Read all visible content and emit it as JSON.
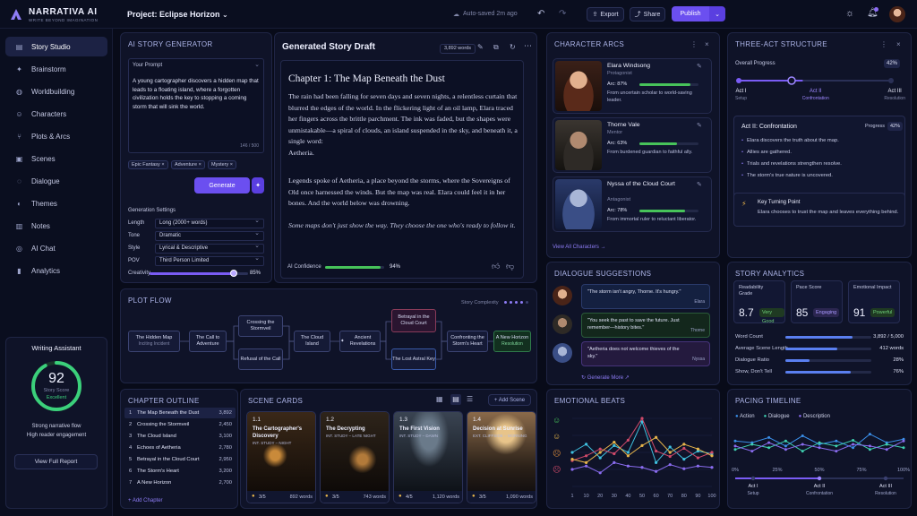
{
  "app": {
    "name": "NARRATIVA AI",
    "tagline": "WRITE BEYOND IMAGINATION"
  },
  "project": {
    "label": "Project: Eclipse Horizon",
    "autosave": "Auto-saved 2m ago"
  },
  "toolbar": {
    "export": "Export",
    "share": "Share",
    "publish": "Publish"
  },
  "sidebar": {
    "items": [
      {
        "label": "Story Studio",
        "icon": "book-icon"
      },
      {
        "label": "Brainstorm",
        "icon": "sparkle-icon"
      },
      {
        "label": "Worldbuilding",
        "icon": "globe-icon"
      },
      {
        "label": "Characters",
        "icon": "person-icon"
      },
      {
        "label": "Plots & Arcs",
        "icon": "branch-icon"
      },
      {
        "label": "Scenes",
        "icon": "film-icon"
      },
      {
        "label": "Dialogue",
        "icon": "chat-icon"
      },
      {
        "label": "Themes",
        "icon": "palette-icon"
      },
      {
        "label": "Notes",
        "icon": "note-icon"
      },
      {
        "label": "AI Chat",
        "icon": "bot-icon"
      },
      {
        "label": "Analytics",
        "icon": "chart-icon"
      }
    ]
  },
  "assistant": {
    "title": "Writing Assistant",
    "score": "92",
    "score_label": "Story Score",
    "score_grade": "Excellent",
    "score_fraction": 0.92,
    "line1": "Strong narrative flow",
    "line2": "High reader engagement",
    "button": "View Full Report"
  },
  "generator": {
    "title": "AI STORY GENERATOR",
    "prompt_label": "Your Prompt",
    "prompt_text": "A young cartographer discovers a hidden map that leads to a floating island, where a forgotten civilization holds the key to stopping a coming storm that will sink the world.",
    "count": "146 / 500",
    "tags": [
      "Epic Fantasy ×",
      "Adventure ×",
      "Mystery ×"
    ],
    "generate": "Generate",
    "settings_title": "Generation Settings",
    "settings": [
      {
        "label": "Length",
        "value": "Long (2000+ words)"
      },
      {
        "label": "Tone",
        "value": "Dramatic"
      },
      {
        "label": "Style",
        "value": "Lyrical & Descriptive"
      },
      {
        "label": "POV",
        "value": "Third Person Limited"
      }
    ],
    "creativity_label": "Creativity",
    "creativity": "85%",
    "creativity_fraction": 0.85
  },
  "draft": {
    "title": "Generated Story Draft",
    "words": "3,892 words",
    "chapter": "Chapter 1: The Map Beneath the Dust",
    "p1": "The rain had been falling for seven days and seven nights, a relentless curtain that blurred the edges of the world. In the flickering light of an oil lamp, Elara traced her fingers across the brittle parchment. The ink was faded, but the shapes were unmistakable—a spiral of clouds, an island suspended in the sky, and beneath it, a single word:",
    "p1b": "Aetheria.",
    "p2": "Legends spoke of Aetheria, a place beyond the storms, where the Sovereigns of Old once harnessed the winds. But the map was real. Elara could feel it in her bones. And the world below was drowning.",
    "p3": "Some maps don't just show the way. They choose the one who's ready to follow it.",
    "confidence_label": "AI Confidence",
    "confidence": "94%",
    "confidence_fraction": 0.94
  },
  "arcs": {
    "title": "CHARACTER ARCS",
    "view_all": "View All Characters →",
    "items": [
      {
        "name": "Elara Windsong",
        "role": "Protagonist",
        "arc": "Arc:  87%",
        "arc_fraction": 0.87,
        "desc": "From uncertain scholar to world-saving leader."
      },
      {
        "name": "Thorne Vale",
        "role": "Mentor",
        "arc": "Arc:  63%",
        "arc_fraction": 0.63,
        "desc": "From burdened guardian to faithful ally."
      },
      {
        "name": "Nyssa of the Cloud Court",
        "role": "Antagonist",
        "arc": "Arc:  78%",
        "arc_fraction": 0.78,
        "desc": "From immortal ruler to reluctant liberator."
      }
    ]
  },
  "acts": {
    "title": "THREE-ACT STRUCTURE",
    "progress_label": "Overall Progress",
    "progress": "42%",
    "progress_fraction": 0.42,
    "steps": [
      {
        "name": "Act I",
        "sub": "Setup"
      },
      {
        "name": "Act II",
        "sub": "Confrontation"
      },
      {
        "name": "Act III",
        "sub": "Resolution"
      }
    ],
    "current": "Act II: Confrontation",
    "current_progress_label": "Progress",
    "current_progress": "42%",
    "bullets": [
      "Elara discovers the truth about the map.",
      "Allies are gathered.",
      "Trials and revelations strengthen resolve.",
      "The storm's true nature is uncovered."
    ],
    "turning_title": "Key Turning Point",
    "turning_text": "Elara chooses to trust the map and leaves everything behind."
  },
  "plot": {
    "title": "PLOT FLOW",
    "complexity_label": "Story Complexity",
    "nodes": [
      "The Hidden Map",
      "Inciting Incident",
      "The Call to Adventure",
      "Crossing the Stormveil",
      "Refusal of the Call",
      "The Cloud Island",
      "Ancient Revelations",
      "Betrayal in the Cloud Court",
      "The Lost Astral Key",
      "Confronting the Storm's Heart",
      "A New Horizon",
      "Resolution"
    ]
  },
  "outline": {
    "title": "CHAPTER OUTLINE",
    "add": "+ Add Chapter",
    "rows": [
      {
        "n": "1",
        "t": "The Map Beneath the Dust",
        "w": "3,892"
      },
      {
        "n": "2",
        "t": "Crossing the Stormveil",
        "w": "2,450"
      },
      {
        "n": "3",
        "t": "The Cloud Island",
        "w": "3,100"
      },
      {
        "n": "4",
        "t": "Echoes of Aetheria",
        "w": "2,780"
      },
      {
        "n": "5",
        "t": "Betrayal in the Cloud Court",
        "w": "2,950"
      },
      {
        "n": "6",
        "t": "The Storm's Heart",
        "w": "3,200"
      },
      {
        "n": "7",
        "t": "A New Horizon",
        "w": "2,700"
      }
    ]
  },
  "scenes": {
    "title": "SCENE CARDS",
    "add": "+ Add Scene",
    "items": [
      {
        "num": "1.1",
        "title": "The Cartographer's Discovery",
        "meta": "INT. STUDY – NIGHT",
        "rating": "3/5",
        "words": "892 words"
      },
      {
        "num": "1.2",
        "title": "The Decrypting",
        "meta": "INT. STUDY – LATE NIGHT",
        "rating": "3/5",
        "words": "743 words"
      },
      {
        "num": "1.3",
        "title": "The First Vision",
        "meta": "INT. STUDY – DAWN",
        "rating": "4/5",
        "words": "1,120 words"
      },
      {
        "num": "1.4",
        "title": "Decision at Sunrise",
        "meta": "EXT. CLIFFSIDE – MORNING",
        "rating": "3/5",
        "words": "1,090 words"
      }
    ]
  },
  "dialogue": {
    "title": "DIALOGUE SUGGESTIONS",
    "generate": "Generate More ↗",
    "items": [
      {
        "text": "\"The storm isn't angry, Thorne. It's hungry.\"",
        "who": "Elara"
      },
      {
        "text": "\"You seek the past to save the future. Just remember—history bites.\"",
        "who": "Thorne"
      },
      {
        "text": "\"Aetheria does not welcome thieves of the sky.\"",
        "who": "Nyssa"
      }
    ]
  },
  "analytics": {
    "title": "STORY ANALYTICS",
    "metrics": [
      {
        "label": "Readability Grade",
        "value": "8.7",
        "badge": "Very Good"
      },
      {
        "label": "Pace Score",
        "value": "85",
        "badge": "Engaging"
      },
      {
        "label": "Emotional Impact",
        "value": "91",
        "badge": "Powerful"
      }
    ],
    "rows": [
      {
        "label": "Word Count",
        "value": "3,892 / 5,000",
        "fraction": 0.78
      },
      {
        "label": "Average Scene Length",
        "value": "412 words",
        "fraction": 0.6
      },
      {
        "label": "Dialogue Ratio",
        "value": "28%",
        "fraction": 0.28
      },
      {
        "label": "Show, Don't Tell",
        "value": "76%",
        "fraction": 0.76
      }
    ]
  },
  "chart_data": [
    {
      "type": "line",
      "title": "EMOTIONAL BEATS",
      "x": [
        1,
        10,
        20,
        30,
        40,
        50,
        60,
        70,
        80,
        90,
        100
      ],
      "series": [
        {
          "color": "#3fc2e0",
          "values": [
            0.5,
            0.62,
            0.42,
            0.6,
            0.5,
            0.95,
            0.35,
            0.58,
            0.4,
            0.52,
            0.48
          ]
        },
        {
          "color": "#d14a6a",
          "values": [
            0.38,
            0.45,
            0.55,
            0.48,
            0.68,
            1.0,
            0.52,
            0.44,
            0.56,
            0.42,
            0.5
          ]
        },
        {
          "color": "#e7b54a",
          "values": [
            0.4,
            0.35,
            0.5,
            0.65,
            0.45,
            0.6,
            0.72,
            0.5,
            0.62,
            0.55,
            0.45
          ]
        },
        {
          "color": "#8a6cf0",
          "values": [
            0.25,
            0.3,
            0.2,
            0.35,
            0.3,
            0.28,
            0.22,
            0.32,
            0.26,
            0.3,
            0.28
          ]
        }
      ]
    },
    {
      "type": "line",
      "title": "PACING TIMELINE",
      "legend": [
        "Action",
        "Dialogue",
        "Description"
      ],
      "xticks": [
        "0%",
        "25%",
        "50%",
        "75%",
        "100%"
      ],
      "series": [
        {
          "name": "Action",
          "color": "#3a8ee8",
          "values": [
            0.6,
            0.55,
            0.7,
            0.45,
            0.75,
            0.5,
            0.6,
            0.4,
            0.8,
            0.55,
            0.65
          ]
        },
        {
          "name": "Dialogue",
          "color": "#3fd0b0",
          "values": [
            0.35,
            0.5,
            0.4,
            0.6,
            0.3,
            0.55,
            0.45,
            0.62,
            0.35,
            0.5,
            0.4
          ]
        },
        {
          "name": "Description",
          "color": "#8a6cf0",
          "values": [
            0.45,
            0.3,
            0.55,
            0.35,
            0.5,
            0.4,
            0.3,
            0.5,
            0.45,
            0.35,
            0.6
          ]
        }
      ],
      "acts": [
        "Act I",
        "Act II",
        "Act III"
      ],
      "act_subs": [
        "Setup",
        "Confrontation",
        "Resolution"
      ]
    }
  ]
}
